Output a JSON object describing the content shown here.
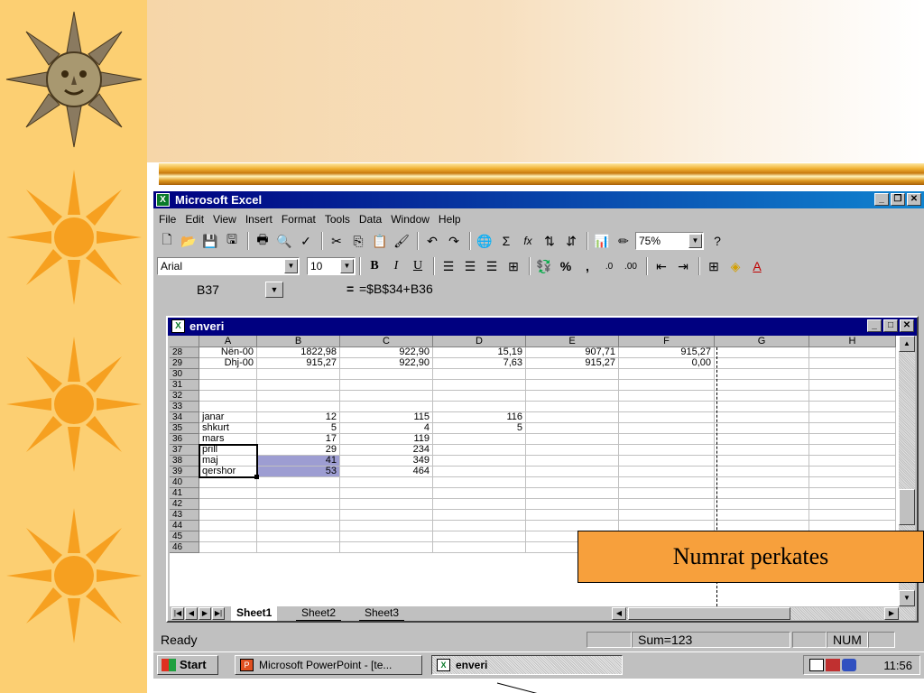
{
  "slide": {
    "callout_text": "Numrat perkates"
  },
  "excel": {
    "app_title": "Microsoft Excel",
    "menu": [
      "File",
      "Edit",
      "View",
      "Insert",
      "Format",
      "Tools",
      "Data",
      "Window",
      "Help"
    ],
    "zoom": "75%",
    "font_name": "Arial",
    "font_size": "10",
    "toolbar_glyphs": {
      "bold": "B",
      "italic": "I",
      "underline": "U",
      "percent": "%",
      "comma": ",",
      "increase_decimal": ".0",
      "decrease_decimal": ".00",
      "autosum": "Σ",
      "function": "fx",
      "help": "?"
    },
    "name_box": "B37",
    "formula_eq": "=",
    "formula": "=$B$34+B36",
    "workbook": {
      "title": "enveri",
      "columns": [
        "A",
        "B",
        "C",
        "D",
        "E",
        "F",
        "G",
        "H"
      ],
      "rows": [
        {
          "num": "28",
          "cells": [
            "Nën-00",
            "1822,98",
            "922,90",
            "15,19",
            "907,71",
            "915,27",
            "",
            ""
          ]
        },
        {
          "num": "29",
          "cells": [
            "Dhj-00",
            "915,27",
            "922,90",
            "7,63",
            "915,27",
            "0,00",
            "",
            ""
          ]
        },
        {
          "num": "30",
          "cells": [
            "",
            "",
            "",
            "",
            "",
            "",
            "",
            ""
          ]
        },
        {
          "num": "31",
          "cells": [
            "",
            "",
            "",
            "",
            "",
            "",
            "",
            ""
          ]
        },
        {
          "num": "32",
          "cells": [
            "",
            "",
            "",
            "",
            "",
            "",
            "",
            ""
          ]
        },
        {
          "num": "33",
          "cells": [
            "",
            "",
            "",
            "",
            "",
            "",
            "",
            ""
          ]
        },
        {
          "num": "34",
          "cells": [
            "janar",
            "12",
            "115",
            "116",
            "",
            "",
            "",
            ""
          ]
        },
        {
          "num": "35",
          "cells": [
            "shkurt",
            "5",
            "4",
            "5",
            "",
            "",
            "",
            ""
          ]
        },
        {
          "num": "36",
          "cells": [
            "mars",
            "17",
            "119",
            "",
            "",
            "",
            "",
            ""
          ]
        },
        {
          "num": "37",
          "cells": [
            "prill",
            "29",
            "234",
            "",
            "",
            "",
            "",
            ""
          ]
        },
        {
          "num": "38",
          "cells": [
            "maj",
            "41",
            "349",
            "",
            "",
            "",
            "",
            ""
          ]
        },
        {
          "num": "39",
          "cells": [
            "qershor",
            "53",
            "464",
            "",
            "",
            "",
            "",
            ""
          ]
        },
        {
          "num": "40",
          "cells": [
            "",
            "",
            "",
            "",
            "",
            "",
            "",
            ""
          ]
        },
        {
          "num": "41",
          "cells": [
            "",
            "",
            "",
            "",
            "",
            "",
            "",
            ""
          ]
        },
        {
          "num": "42",
          "cells": [
            "",
            "",
            "",
            "",
            "",
            "",
            "",
            ""
          ]
        },
        {
          "num": "43",
          "cells": [
            "",
            "",
            "",
            "",
            "",
            "",
            "",
            ""
          ]
        },
        {
          "num": "44",
          "cells": [
            "",
            "",
            "",
            "",
            "",
            "",
            "",
            ""
          ]
        },
        {
          "num": "45",
          "cells": [
            "",
            "",
            "",
            "",
            "",
            "",
            "",
            ""
          ]
        },
        {
          "num": "46",
          "cells": [
            "",
            "",
            "",
            "",
            "",
            "",
            "",
            ""
          ]
        }
      ],
      "sheets": [
        "Sheet1",
        "Sheet2",
        "Sheet3"
      ],
      "active_sheet": "Sheet1"
    },
    "status": {
      "ready": "Ready",
      "sum": "Sum=123",
      "num": "NUM"
    }
  },
  "taskbar": {
    "start": "Start",
    "tasks": [
      {
        "label": "Microsoft PowerPoint - [te...",
        "active": false
      },
      {
        "label": "enveri",
        "active": true
      }
    ],
    "clock": "11:56"
  },
  "colors": {
    "slide_left_band": "#fccf72",
    "callout_fill": "#f7a03c",
    "selection_fill": "#9d9dd2",
    "title_bar": "#000080"
  }
}
